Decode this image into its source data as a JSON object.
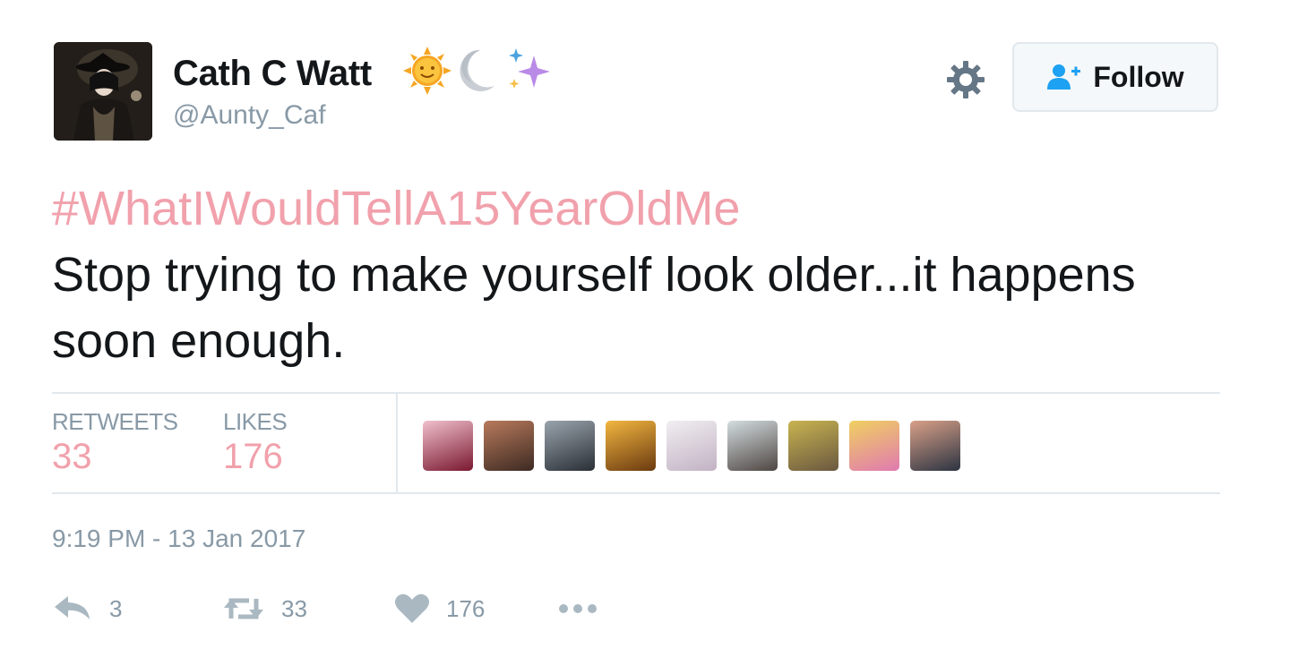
{
  "author": {
    "name": "Cath C Watt",
    "handle": "@Aunty_Caf",
    "name_emojis": [
      "sun-with-face-icon",
      "crescent-moon-icon",
      "sparkles-icon"
    ]
  },
  "follow_button": {
    "label": "Follow",
    "icon": "add-user-icon"
  },
  "tweet": {
    "hashtag": "#WhatIWouldTellA15YearOldMe",
    "text": "Stop trying to make yourself look older...it happens soon enough."
  },
  "stats": {
    "retweets_label": "RETWEETS",
    "retweets_value": "33",
    "likes_label": "LIKES",
    "likes_value": "176"
  },
  "likers": [
    {
      "name": "liker-avatar-1",
      "colors": [
        "#f0c0cc",
        "#7a1830"
      ]
    },
    {
      "name": "liker-avatar-2",
      "colors": [
        "#b87a5c",
        "#3d2a22"
      ]
    },
    {
      "name": "liker-avatar-3",
      "colors": [
        "#9aa4ad",
        "#2a2f36"
      ]
    },
    {
      "name": "liker-avatar-4",
      "colors": [
        "#f2b640",
        "#6b3a10"
      ]
    },
    {
      "name": "liker-avatar-5",
      "colors": [
        "#f1eef1",
        "#c2b2c4"
      ]
    },
    {
      "name": "liker-avatar-6",
      "colors": [
        "#d3dde0",
        "#4f4642"
      ]
    },
    {
      "name": "liker-avatar-7",
      "colors": [
        "#c8b450",
        "#6a5840"
      ]
    },
    {
      "name": "liker-avatar-8",
      "colors": [
        "#f0d060",
        "#e07ab0"
      ]
    },
    {
      "name": "liker-avatar-9",
      "colors": [
        "#d9a088",
        "#2c3442"
      ]
    }
  ],
  "timestamp": "9:19 PM - 13 Jan 2017",
  "actions": {
    "reply_count": "3",
    "retweet_count": "33",
    "like_count": "176"
  },
  "colors": {
    "hashtag": "#f1a1ac",
    "muted": "#8899a6",
    "divider": "#e1e8ed",
    "follow_icon": "#1da1f2"
  }
}
